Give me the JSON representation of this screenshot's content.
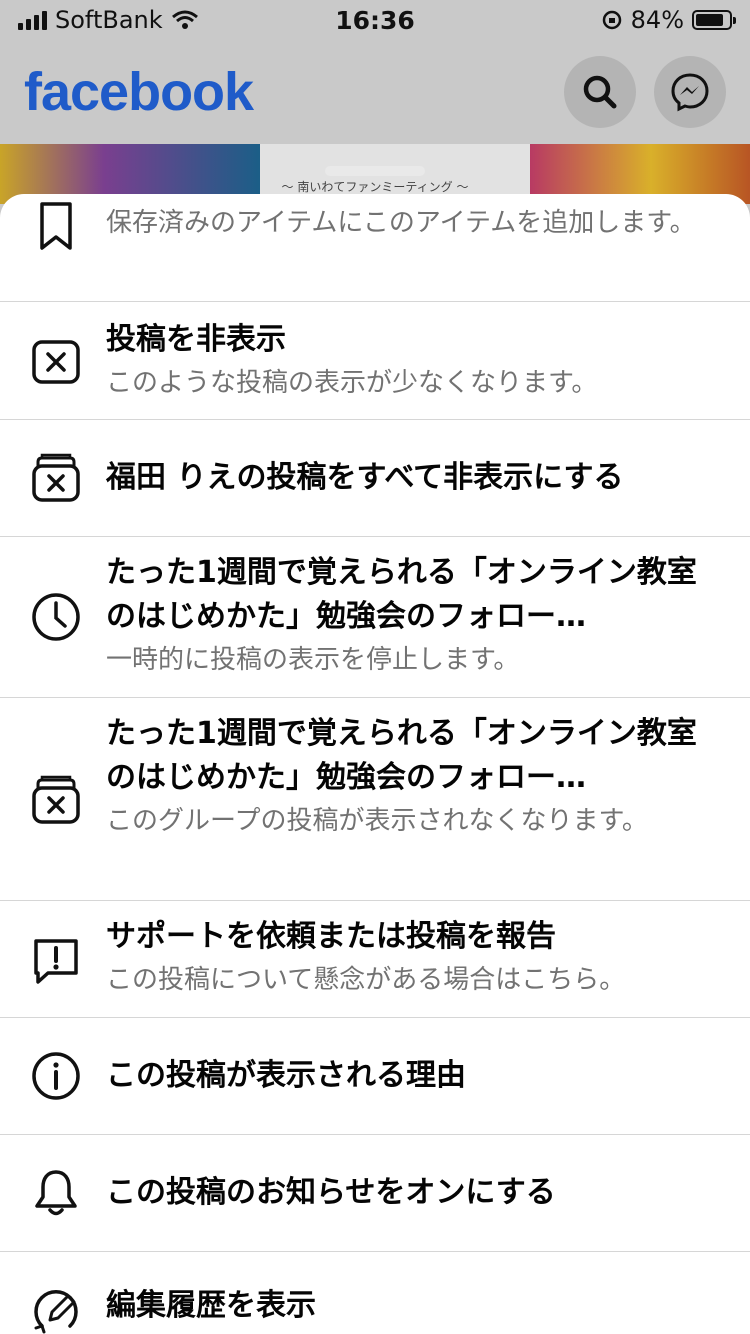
{
  "status_bar": {
    "carrier": "SoftBank",
    "time": "16:36",
    "battery": "84%",
    "battery_level": 0.84
  },
  "header": {
    "logo": "facebook"
  },
  "banner": {
    "caption": "～ 南いわてファンミーティング ～"
  },
  "menu": [
    {
      "icon": "bookmark-icon",
      "title": "",
      "subtitle": "保存済みのアイテムにこのアイテムを追加します。"
    },
    {
      "icon": "hide-post-icon",
      "title": "投稿を非表示",
      "subtitle": "このような投稿の表示が少なくなります。"
    },
    {
      "icon": "hide-all-icon",
      "title": "福田 りえの投稿をすべて非表示にする",
      "subtitle": ""
    },
    {
      "icon": "clock-icon",
      "title": "たった1週間で覚えられる「オンライン教室のはじめかた」勉強会のフォロー…",
      "subtitle": "一時的に投稿の表示を停止します。"
    },
    {
      "icon": "hide-group-icon",
      "title": "たった1週間で覚えられる「オンライン教室のはじめかた」勉強会のフォロー…",
      "subtitle": "このグループの投稿が表示されなくなります。"
    },
    {
      "icon": "report-icon",
      "title": "サポートを依頼または投稿を報告",
      "subtitle": "この投稿について懸念がある場合はこちら。"
    },
    {
      "icon": "info-icon",
      "title": "この投稿が表示される理由",
      "subtitle": ""
    },
    {
      "icon": "bell-icon",
      "title": "この投稿のお知らせをオンにする",
      "subtitle": ""
    },
    {
      "icon": "edit-history-icon",
      "title": "編集履歴を表示",
      "subtitle": ""
    }
  ]
}
